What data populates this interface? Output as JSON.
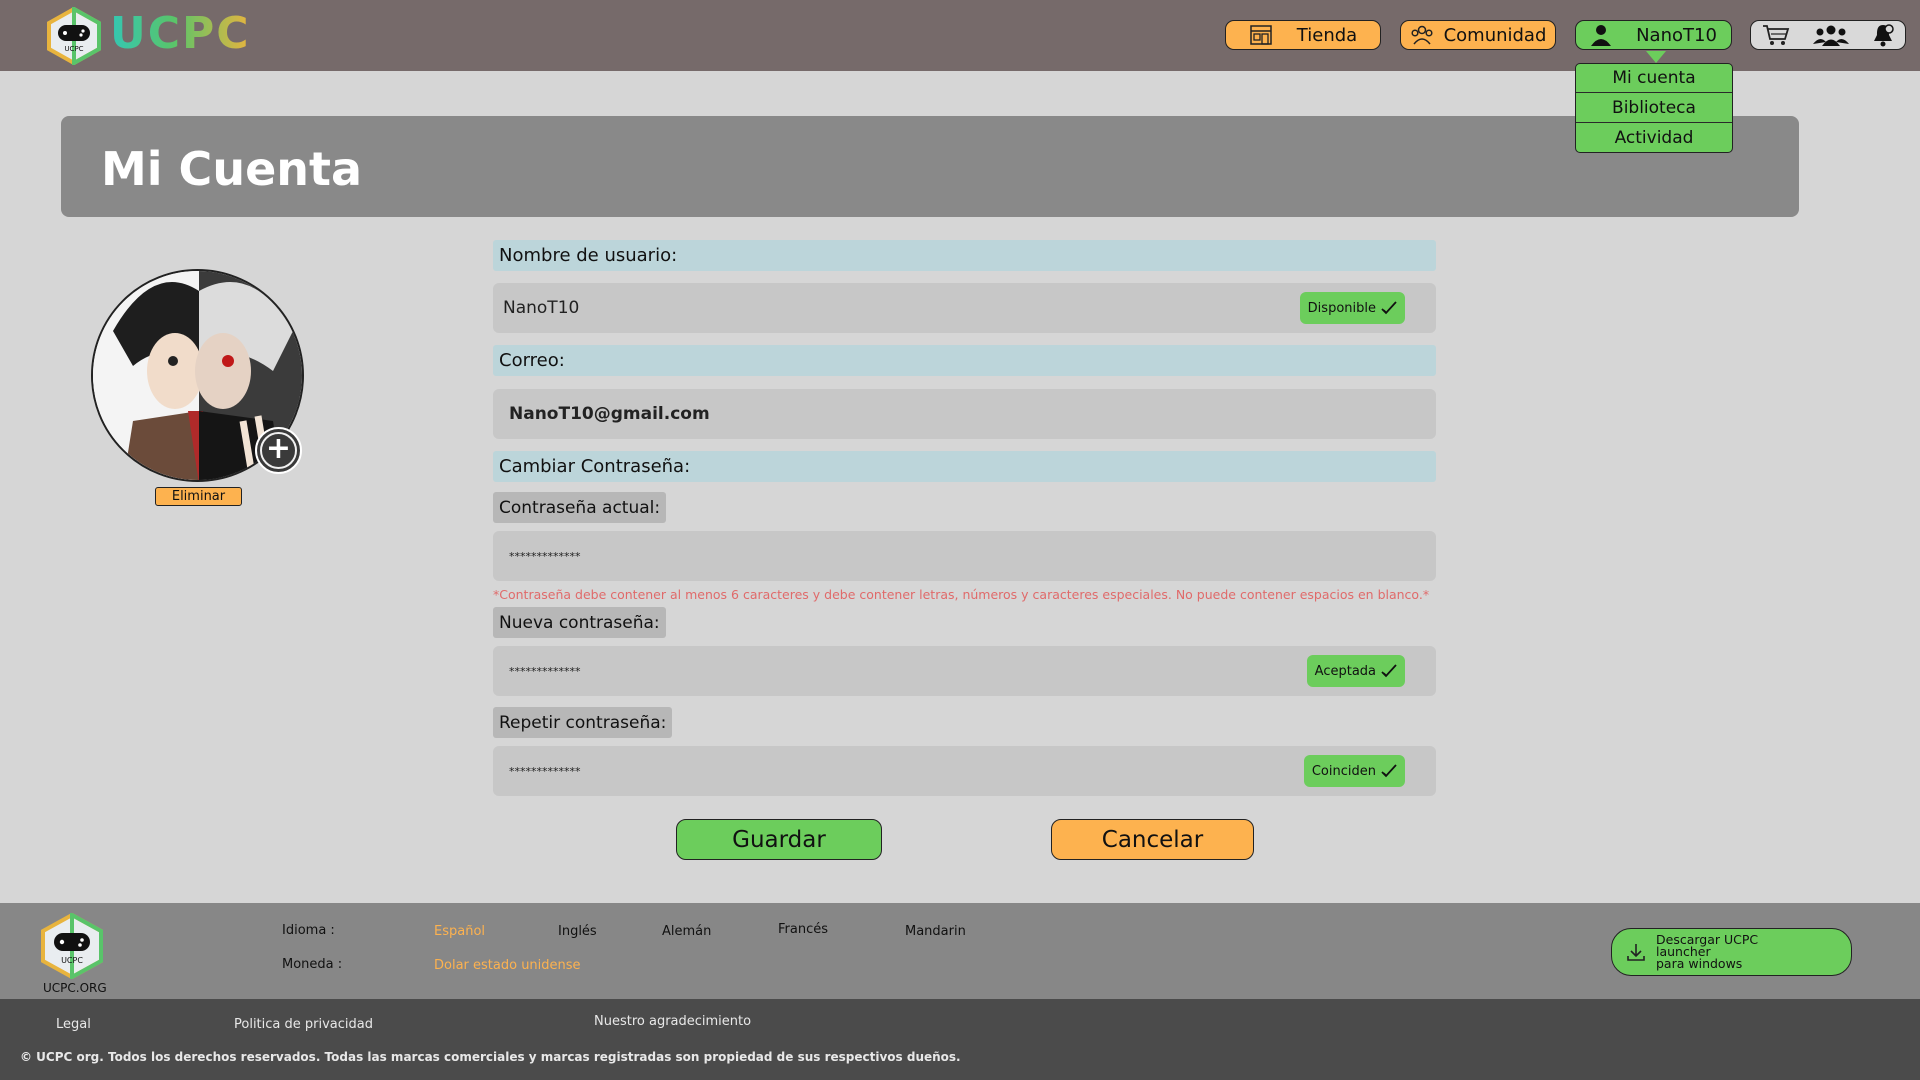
{
  "header": {
    "brand": "UCPC",
    "logo_text": "UCPC",
    "nav": {
      "store": "Tienda",
      "community": "Comunidad",
      "user": "NanoT10"
    },
    "dropdown": [
      "Mi cuenta",
      "Biblioteca",
      "Actividad"
    ],
    "icons": [
      "cart-icon",
      "friends-icon",
      "notifications-icon"
    ]
  },
  "page": {
    "title": "Mi Cuenta"
  },
  "avatar": {
    "delete_label": "Eliminar"
  },
  "form": {
    "username_label": "Nombre de usuario:",
    "username_value": "NanoT10",
    "username_status": "Disponible",
    "email_label": "Correo:",
    "email_value": "NanoT10@gmail.com",
    "change_password_label": "Cambiar Contraseña:",
    "current_password_label": "Contraseña actual:",
    "current_password_value": "*************",
    "password_hint": "*Contraseña debe contener al menos 6 caracteres y debe contener letras, números y caracteres especiales. No puede contener espacios en blanco.*",
    "new_password_label": "Nueva contraseña:",
    "new_password_value": "*************",
    "new_password_status": "Aceptada",
    "repeat_password_label": "Repetir contraseña:",
    "repeat_password_value": "*************",
    "repeat_password_status": "Coinciden",
    "save_label": "Guardar",
    "cancel_label": "Cancelar"
  },
  "footer": {
    "org": "UCPC.ORG",
    "language_label": "Idioma :",
    "languages": [
      "Español",
      "Inglés",
      "Alemán",
      "Francés",
      "Mandarin"
    ],
    "currency_label": "Moneda :",
    "currency_value": "Dolar estado unidense",
    "download_line1": "Descargar UCPC",
    "download_line2": "launcher",
    "download_line3": "para windows",
    "legal": "Legal",
    "privacy": "Politica de privacidad",
    "thanks": "Nuestro agradecimiento",
    "copyright": "© UCPC org. Todos los derechos reservados. Todas las marcas comerciales y marcas registradas son propiedad de sus respectivos dueños."
  },
  "colors": {
    "topbar": "#766a6a",
    "accent_orange": "#fdb24f",
    "accent_green": "#6ccd5c",
    "section_label": "#bcd5da",
    "hint_red": "#e06a6a"
  }
}
